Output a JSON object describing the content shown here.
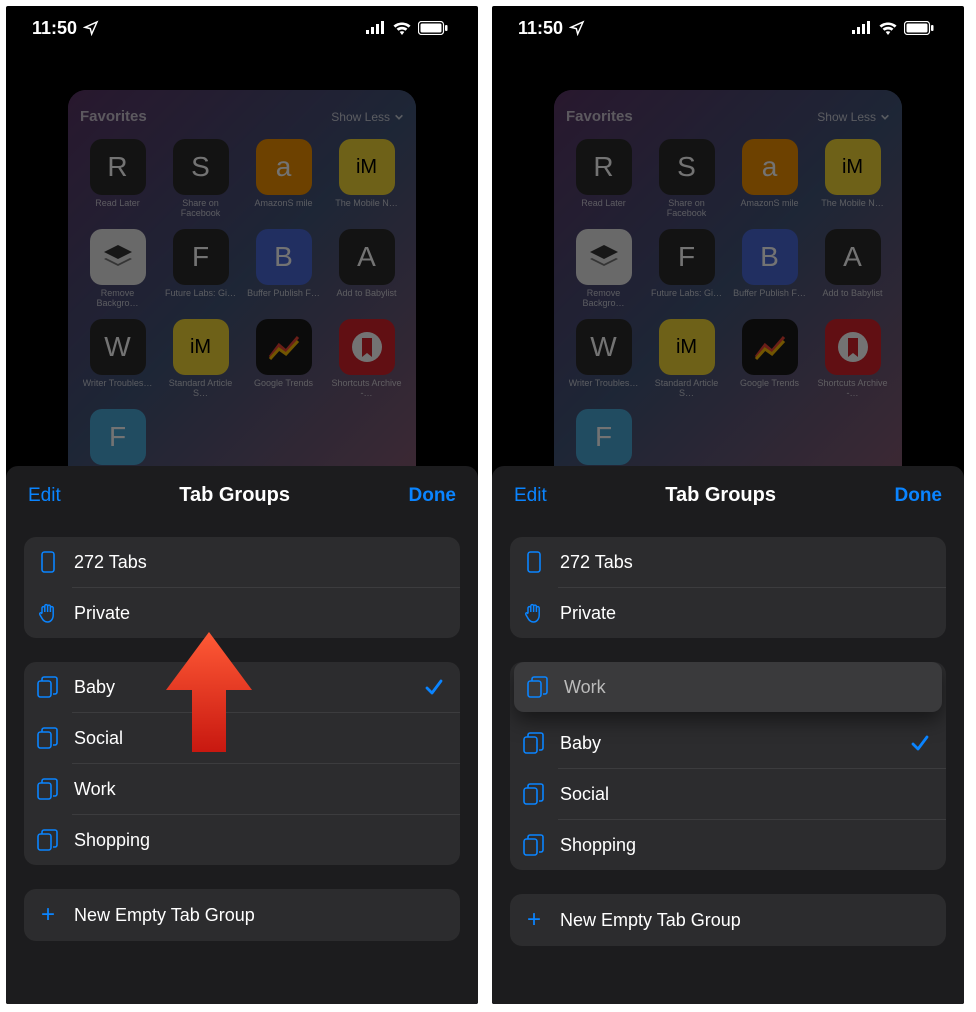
{
  "status": {
    "time": "11:50"
  },
  "preview": {
    "fav_header": "Favorites",
    "show_less": "Show Less",
    "items": [
      {
        "letter": "R",
        "bg": "#2b2b2b",
        "label": "Read Later"
      },
      {
        "letter": "S",
        "bg": "#2b2b2b",
        "label": "Share on Facebook"
      },
      {
        "letter": "a",
        "bg": "#f29100",
        "label": "AmazonS mile"
      },
      {
        "letter": "iM",
        "bg": "#f4d735",
        "label": "The Mobile N…",
        "fg": "#000",
        "fs": "20px"
      },
      {
        "svg": "stack",
        "bg": "#e8e8e8",
        "label": "Remove Backgro…"
      },
      {
        "letter": "F",
        "bg": "#2b2b2b",
        "label": "Future Labs: Gi…"
      },
      {
        "letter": "B",
        "bg": "#4a68d8",
        "label": "Buffer Publish F…"
      },
      {
        "letter": "A",
        "bg": "#2b2b2b",
        "label": "Add to Babylist"
      },
      {
        "letter": "W",
        "bg": "#2b2b2b",
        "label": "Writer Troubles…"
      },
      {
        "letter": "iM",
        "bg": "#f4d735",
        "label": "Standard Article S…",
        "fg": "#000",
        "fs": "20px"
      },
      {
        "svg": "trends",
        "bg": "#1a1a1a",
        "label": "Google Trends"
      },
      {
        "svg": "bookmark",
        "bg": "#d8232a",
        "label": "Shortcuts Archive -…"
      },
      {
        "letter": "F",
        "bg": "#4aa8d8",
        "label": ""
      }
    ]
  },
  "sheet": {
    "title": "Tab Groups",
    "edit": "Edit",
    "done": "Done",
    "tabs_count": "272 Tabs",
    "private": "Private",
    "new_group": "New Empty Tab Group"
  },
  "left_groups": [
    {
      "name": "Baby",
      "checked": true
    },
    {
      "name": "Social",
      "checked": false
    },
    {
      "name": "Work",
      "checked": false
    },
    {
      "name": "Shopping",
      "checked": false
    }
  ],
  "right_floating": "Work",
  "right_groups": [
    {
      "name": "Baby",
      "checked": true
    },
    {
      "name": "Social",
      "checked": false
    },
    {
      "name": "Shopping",
      "checked": false
    }
  ]
}
